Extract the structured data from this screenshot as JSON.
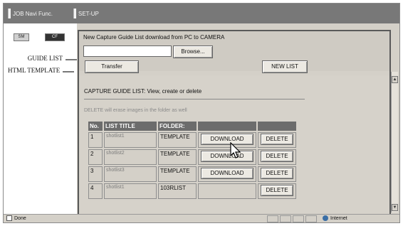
{
  "header": {
    "tabs": [
      {
        "label": "JOB Navi Func."
      },
      {
        "label": "SET-UP"
      }
    ]
  },
  "left_nav": {
    "camera_buttons": [
      "SM",
      "CF"
    ],
    "items": [
      {
        "label": "GUIDE LIST"
      },
      {
        "label": "HTML TEMPLATE"
      }
    ]
  },
  "download": {
    "title": "New Capture Guide List download from PC to CAMERA",
    "file_value": "",
    "browse_label": "Browse...",
    "transfer_label": "Transfer",
    "new_list_label": "NEW LIST"
  },
  "guide_list": {
    "title": "CAPTURE GUIDE LIST: View, create or delete",
    "note": "DELETE will erase images in the folder as well",
    "columns": [
      "No.",
      "LIST TITLE",
      "FOLDER:",
      "",
      ""
    ],
    "rows": [
      {
        "no": "1",
        "title": "shotlist1",
        "folder": "TEMPLATE",
        "download": "DOWNLOAD",
        "delete": "DELETE"
      },
      {
        "no": "2",
        "title": "shotlist2",
        "folder": "TEMPLATE",
        "download": "DOWNLOAD",
        "delete": "DELETE"
      },
      {
        "no": "3",
        "title": "shotlist3",
        "folder": "TEMPLATE",
        "download": "DOWNLOAD",
        "delete": "DELETE"
      },
      {
        "no": "4",
        "title": "shotlist1",
        "folder": "103RLIST",
        "download": null,
        "delete": "DELETE"
      }
    ]
  },
  "status_bar": {
    "status": "Done",
    "zone": "Internet"
  },
  "colors": {
    "header_bg": "#787878",
    "panel_bg": "#d4d0c8",
    "table_header_bg": "#6c6c6c"
  },
  "icons": [
    "notch-icon",
    "arrow-icon",
    "cursor-icon",
    "scroll-up-icon",
    "scroll-down-icon",
    "ie-page-icon",
    "globe-icon"
  ]
}
